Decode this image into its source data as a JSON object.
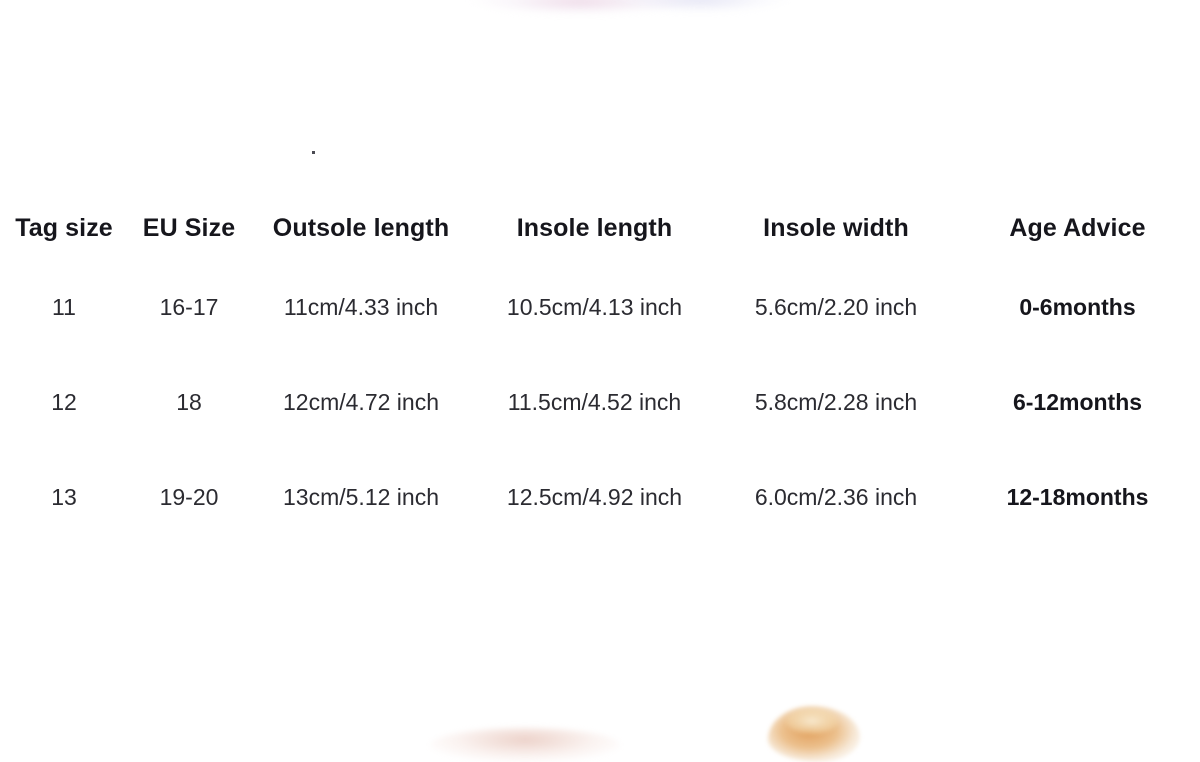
{
  "chart_data": {
    "type": "table",
    "title": "",
    "columns": [
      "Tag size",
      "EU Size",
      "Outsole length",
      "Insole length",
      "Insole width",
      "Age Advice"
    ],
    "rows": [
      [
        "11",
        "16-17",
        "11cm/4.33 inch",
        "10.5cm/4.13 inch",
        "5.6cm/2.20 inch",
        "0-6months"
      ],
      [
        "12",
        "18",
        "12cm/4.72 inch",
        "11.5cm/4.52 inch",
        "5.8cm/2.28 inch",
        "6-12months"
      ],
      [
        "13",
        "19-20",
        "13cm/5.12 inch",
        "12.5cm/4.92 inch",
        "6.0cm/2.36 inch",
        "12-18months"
      ]
    ]
  },
  "table": {
    "headers": {
      "tag_size": "Tag size",
      "eu_size": "EU Size",
      "outsole_length": "Outsole length",
      "insole_length": "Insole length",
      "insole_width": "Insole width",
      "age_advice": "Age Advice"
    },
    "rows": [
      {
        "tag_size": "11",
        "eu_size": "16-17",
        "outsole_length": "11cm/4.33 inch",
        "insole_length": "10.5cm/4.13 inch",
        "insole_width": "5.6cm/2.20 inch",
        "age_advice": "0-6months"
      },
      {
        "tag_size": "12",
        "eu_size": "18",
        "outsole_length": "12cm/4.72 inch",
        "insole_length": "11.5cm/4.52 inch",
        "insole_width": "5.8cm/2.28 inch",
        "age_advice": "6-12months"
      },
      {
        "tag_size": "13",
        "eu_size": "19-20",
        "outsole_length": "13cm/5.12 inch",
        "insole_length": "12.5cm/4.92 inch",
        "insole_width": "6.0cm/2.36 inch",
        "age_advice": "12-18months"
      }
    ]
  },
  "colors": {
    "background": "#ffffff",
    "header_text": "#16161c",
    "body_text": "#2b2b31"
  }
}
